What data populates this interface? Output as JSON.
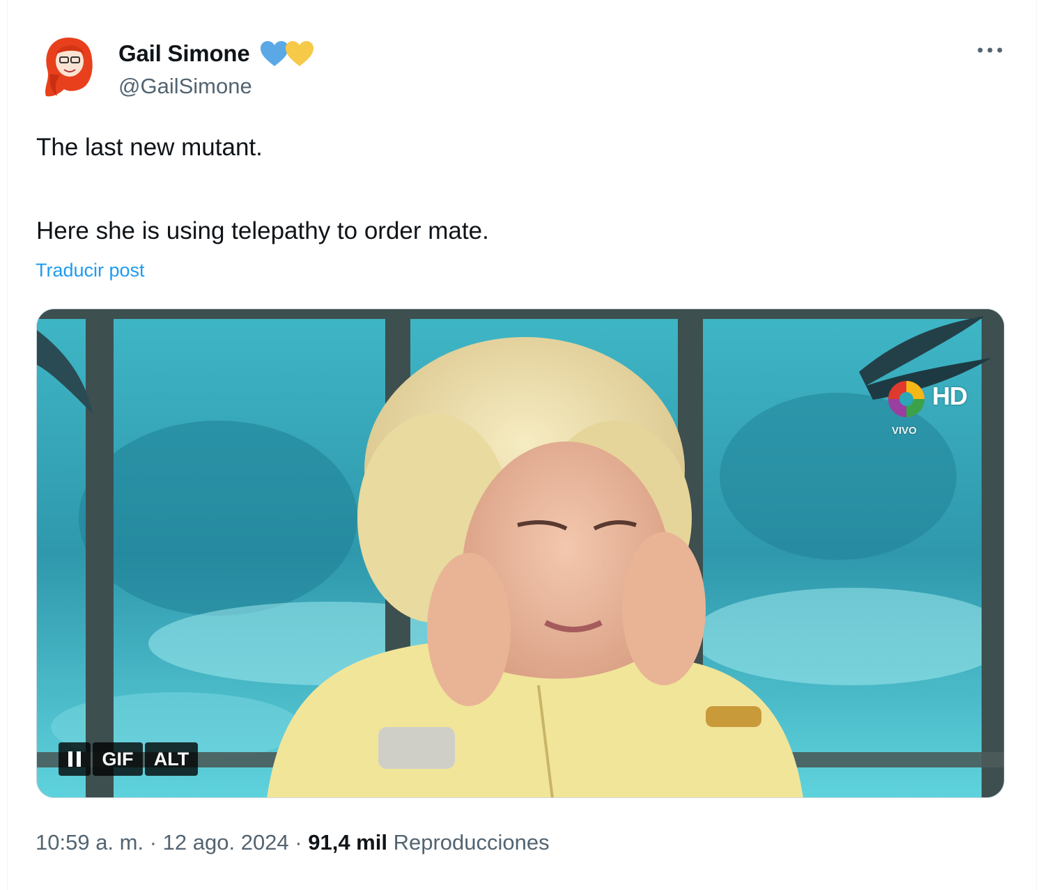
{
  "author": {
    "name": "Gail Simone",
    "handle": "@GailSimone",
    "avatar_icon": "redhead-avatar-icon",
    "badges": [
      "blue-heart-icon",
      "yellow-heart-icon"
    ]
  },
  "tweet": {
    "lines": [
      "The last new mutant.",
      "Here she is using telepathy to order mate."
    ],
    "translate_label": "Traducir post"
  },
  "media": {
    "type": "gif",
    "controls": {
      "pause_icon": "pause-icon",
      "gif_label": "GIF",
      "alt_label": "ALT"
    },
    "overlay": {
      "channel_badge": "HD",
      "live_label": "VIVO"
    }
  },
  "meta": {
    "time": "10:59 a. m.",
    "separator": " · ",
    "date": "12 ago. 2024",
    "views_count": "91,4 mil",
    "views_label": "Reproducciones"
  },
  "colors": {
    "link": "#1d9bf0",
    "secondary_text": "#536471",
    "heart_blue": "#5aa9e6",
    "heart_yellow": "#f7c948"
  }
}
